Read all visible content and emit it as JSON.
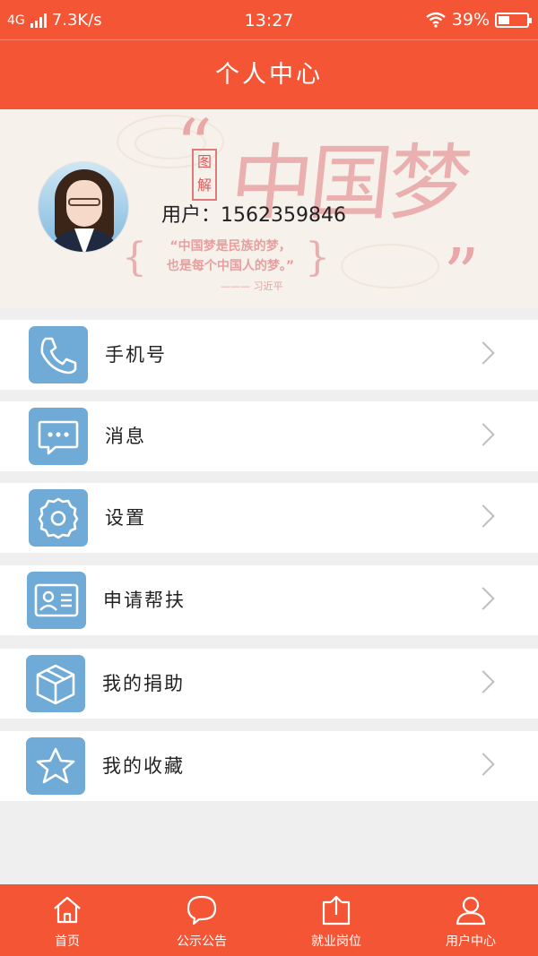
{
  "status_bar": {
    "network": "4G",
    "speed": "7.3K/s",
    "time": "13:27",
    "battery": "39%",
    "battery_level": 0.39
  },
  "header": {
    "title": "个人中心"
  },
  "banner": {
    "stamp": "图解",
    "title": "中国梦",
    "quote_line1": "“中国梦是民族的梦，",
    "quote_line2": "也是每个中国人的梦。”",
    "signature": "——— 习近平",
    "user_label": "用户：1562359846"
  },
  "menu": [
    {
      "label": "手机号",
      "icon": "phone-icon"
    },
    {
      "label": "消息",
      "icon": "message-icon"
    },
    {
      "label": "设置",
      "icon": "gear-icon"
    },
    {
      "label": "申请帮扶",
      "icon": "id-card-icon"
    },
    {
      "label": "我的捐助",
      "icon": "box-icon"
    },
    {
      "label": "我的收藏",
      "icon": "star-icon"
    }
  ],
  "tabs": [
    {
      "label": "首页",
      "icon": "home-icon"
    },
    {
      "label": "公示公告",
      "icon": "chat-bubble-icon"
    },
    {
      "label": "就业岗位",
      "icon": "upload-icon"
    },
    {
      "label": "用户中心",
      "icon": "user-icon"
    }
  ],
  "colors": {
    "brand": "#f45535",
    "icon_bg": "#6fabd6",
    "page_bg": "#efefef"
  }
}
